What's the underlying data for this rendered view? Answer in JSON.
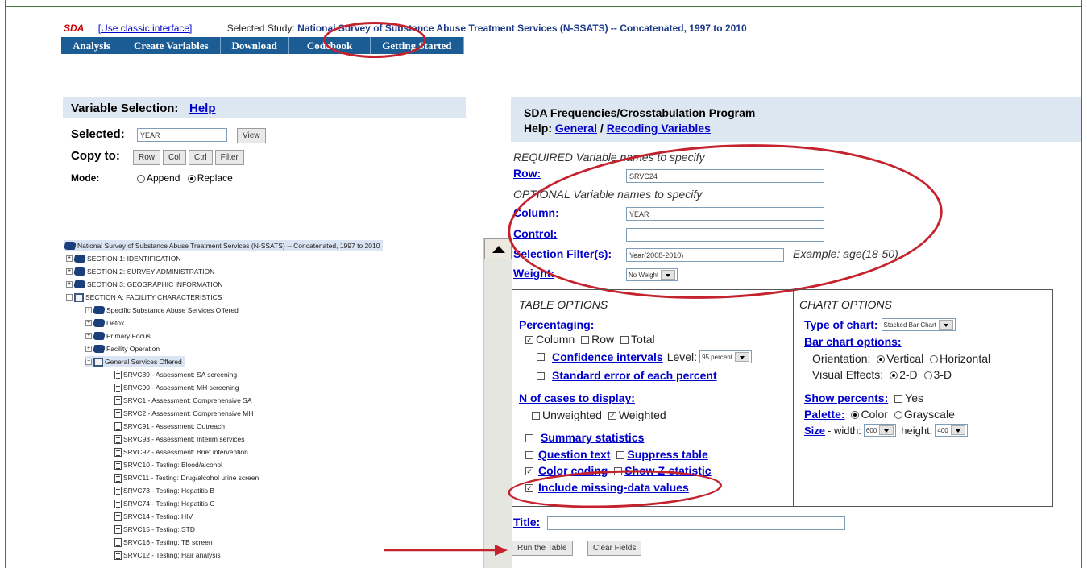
{
  "header": {
    "sda_label": "SDA",
    "classic_link": "[Use classic interface]",
    "study_prefix": "Selected Study:",
    "study_title": "National Survey of Substance Abuse Treatment Services (N-SSATS) -- Concatenated, 1997 to 2010"
  },
  "nav": [
    "Analysis",
    "Create Variables",
    "Download",
    "Codebook",
    "Getting Started"
  ],
  "left": {
    "title": "Variable Selection:",
    "help": "Help",
    "selected_label": "Selected:",
    "selected_value": "YEAR",
    "view_button": "View",
    "copy_to_label": "Copy to:",
    "copy_buttons": [
      "Row",
      "Col",
      "Ctrl",
      "Filter"
    ],
    "mode_label": "Mode:",
    "mode_append": "Append",
    "mode_replace": "Replace"
  },
  "tree": {
    "root": "National Survey of Substance Abuse Treatment Services (N-SSATS) -- Concatenated, 1997 to 2010",
    "sections": [
      "SECTION 1: IDENTIFICATION",
      "SECTION 2: SURVEY ADMINISTRATION",
      "SECTION 3: GEOGRAPHIC INFORMATION",
      "SECTION A: FACILITY CHARACTERISTICS"
    ],
    "subsections": [
      "Specific Substance Abuse Services Offered",
      "Detox",
      "Primary Focus",
      "Facility Operation",
      "General Services Offered"
    ],
    "variables": [
      "SRVC89 - Assessment: SA screening",
      "SRVC90 - Assessment: MH screening",
      "SRVC1 - Assessment: Comprehensive SA",
      "SRVC2 - Assessment: Comprehensive MH",
      "SRVC91 - Assessment: Outreach",
      "SRVC93 - Assessment: Interim services",
      "SRVC92 - Assessment: Brief intervention",
      "SRVC10 - Testing: Blood/alcohol",
      "SRVC11 - Testing: Drug/alcohol urine screen",
      "SRVC73 - Testing: Hepatitis B",
      "SRVC74 - Testing: Hepatitis C",
      "SRVC14 - Testing: HIV",
      "SRVC15 - Testing: STD",
      "SRVC16 - Testing: TB screen",
      "SRVC12 - Testing: Hair analysis"
    ]
  },
  "right": {
    "title": "SDA Frequencies/Crosstabulation Program",
    "help_label": "Help:",
    "help_general": "General",
    "help_sep": "/",
    "help_recoding": "Recoding Variables",
    "required_label": "REQUIRED Variable names to specify",
    "row_label": "Row:",
    "row_value": "SRVC24",
    "optional_label": "OPTIONAL Variable names to specify",
    "column_label": "Column:",
    "column_value": "YEAR",
    "control_label": "Control:",
    "control_value": "",
    "filter_label": "Selection Filter(s):",
    "filter_value": "Year(2008-2010)",
    "filter_example": "Example: age(18-50)",
    "weight_label": "Weight:",
    "weight_value": "No Weight"
  },
  "table_options": {
    "heading": "TABLE OPTIONS",
    "percentaging": "Percentaging:",
    "column": "Column",
    "row": "Row",
    "total": "Total",
    "confidence": "Confidence intervals",
    "level_label": "Level:",
    "level_value": "95 percent",
    "std_error": "Standard error of each percent",
    "n_cases": "N of cases to display:",
    "unweighted": "Unweighted",
    "weighted": "Weighted",
    "summary": "Summary statistics",
    "question_text": "Question text",
    "suppress": "Suppress table",
    "color_coding": "Color coding",
    "z_stat": "Show Z-statistic",
    "missing": "Include missing-data values"
  },
  "chart_options": {
    "heading": "CHART OPTIONS",
    "type_label": "Type of chart:",
    "type_value": "Stacked Bar Chart",
    "bar_options": "Bar chart options:",
    "orientation_label": "Orientation:",
    "vertical": "Vertical",
    "horizontal": "Horizontal",
    "effects_label": "Visual Effects:",
    "two_d": "2-D",
    "three_d": "3-D",
    "show_percents": "Show percents:",
    "yes": "Yes",
    "palette": "Palette:",
    "color": "Color",
    "grayscale": "Grayscale",
    "size": "Size",
    "width_label": "- width:",
    "width_value": "600",
    "height_label": "height:",
    "height_value": "400"
  },
  "bottom": {
    "title_label": "Title:",
    "run_button": "Run the Table",
    "clear_button": "Clear Fields"
  },
  "colors": {
    "accent_red": "#c4232e",
    "nav_blue": "#1c5c94",
    "link_blue": "#0000cc",
    "border_green": "#3d7d34"
  }
}
